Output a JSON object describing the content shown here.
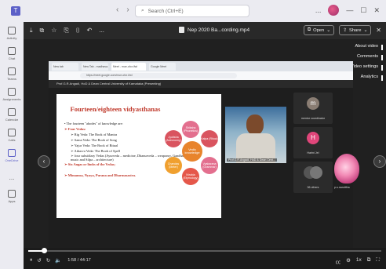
{
  "titlebar": {
    "search_placeholder": "Search (Ctrl+E)",
    "more": "...",
    "minimize": "—",
    "maximize": "☐",
    "close": "✕"
  },
  "rail": {
    "items": [
      {
        "label": "Activity"
      },
      {
        "label": "Chat"
      },
      {
        "label": "Teams"
      },
      {
        "label": "Assignments"
      },
      {
        "label": "Calendar"
      },
      {
        "label": "Calls"
      },
      {
        "label": "OneDrive"
      },
      {
        "label": "..."
      },
      {
        "label": "Apps"
      }
    ]
  },
  "viewer": {
    "file_name": "Nep 2020 Ba...cording.mp4",
    "open_label": "Open",
    "share_label": "Share",
    "more": "...",
    "close": "✕",
    "right_panel": [
      "About video",
      "Comments",
      "Video settings",
      "Analytics"
    ]
  },
  "browser": {
    "tabs": [
      "New tab",
      "New Tab - madhava.shuk...",
      "Meet - mue-ofor-ifwl",
      "Google Meet"
    ],
    "url": "https://meet.google.com/mue-ofor-ifwl"
  },
  "meet": {
    "presenting": "Prof.G.R.Angadi, HoD & Dean Central University of Karnataka (Presenting)",
    "time": "4:32 PM",
    "meeting_code": "mue-ofor-ifwl",
    "camera_name": "Prof.G.R.Angadi, HoD & Dean Cent...",
    "tiles": [
      {
        "initial": "m",
        "name": "mentor coordinator",
        "color": "#8a7d73"
      },
      {
        "initial": "H",
        "name": "Harini JeI",
        "color": "#e0467a"
      },
      {
        "initial": "",
        "name": "36 others",
        "color": "#555"
      }
    ],
    "extra_name": "p.s.nanditha"
  },
  "slide": {
    "title": "Fourteen/eighteen vidyasthanas",
    "lines": [
      {
        "text": "• The fourteen \"abodes\" of knowledge are:",
        "cls": ""
      },
      {
        "text": "➢ Four Vedas:",
        "cls": "red"
      },
      {
        "text": "➢ Rig Veda: The Book of Mantra",
        "cls": "sub"
      },
      {
        "text": "➢ Sama Veda: The Book of Song",
        "cls": "sub"
      },
      {
        "text": "➢ Yajur Veda: The Book of Ritual",
        "cls": "sub"
      },
      {
        "text": "➢ Atharva Veda: The Book of Spell",
        "cls": "sub"
      },
      {
        "text": "➢ four subsidiary Vedas (Ayurveda – medicine, Dhanurveda – weaponry, Gandharvaveda – music and Silpa – architecture)",
        "cls": "sub"
      },
      {
        "text": "➢ Six Angas or limbs of the Vedas;",
        "cls": "red"
      },
      {
        "text": "",
        "cls": ""
      },
      {
        "text": "➢ Mimamsa, Nyaya, Purana and Dharmasastra.",
        "cls": "red"
      }
    ],
    "center": "Vedic knowledge",
    "circles": [
      "Shiksha (Phonetics)",
      "Kalpa (Ritual)",
      "Vyakarana (Grammar)",
      "Nirukta (Etymology)",
      "Chandas (Meter)",
      "Jyotisha (Astronomy)"
    ]
  },
  "player": {
    "time": "1:58 / 44:17",
    "progress": 0.045
  }
}
